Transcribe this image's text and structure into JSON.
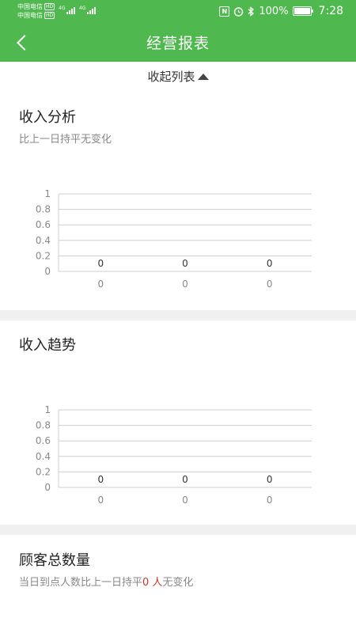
{
  "status_bar": {
    "carrier1": "中国电信",
    "carrier2": "中国电信",
    "hd": "HD",
    "net1": "4G",
    "net2": "4G",
    "nfc": "N",
    "battery": "100%",
    "time": "7:28"
  },
  "header": {
    "title": "经营报表"
  },
  "collapse": {
    "label": "收起列表"
  },
  "sections": [
    {
      "title": "收入分析",
      "subtitle": "比上一日持平无变化"
    },
    {
      "title": "收入趋势"
    },
    {
      "title": "顾客总数量",
      "subtitle_prefix": "当日到点人数比上一日持平",
      "subtitle_value": "0 人",
      "subtitle_suffix": "无变化"
    }
  ],
  "chart_data": [
    {
      "type": "bar",
      "categories": [
        "0",
        "0",
        "0"
      ],
      "values": [
        0,
        0,
        0
      ],
      "data_labels": [
        "0",
        "0",
        "0"
      ],
      "ylim": [
        0,
        1
      ],
      "yticks": [
        "0",
        "0.2",
        "0.4",
        "0.6",
        "0.8",
        "1"
      ],
      "grid": true
    },
    {
      "type": "bar",
      "categories": [
        "0",
        "0",
        "0"
      ],
      "values": [
        0,
        0,
        0
      ],
      "data_labels": [
        "0",
        "0",
        "0"
      ],
      "ylim": [
        0,
        1
      ],
      "yticks": [
        "0",
        "0.2",
        "0.4",
        "0.6",
        "0.8",
        "1"
      ],
      "grid": true
    }
  ]
}
